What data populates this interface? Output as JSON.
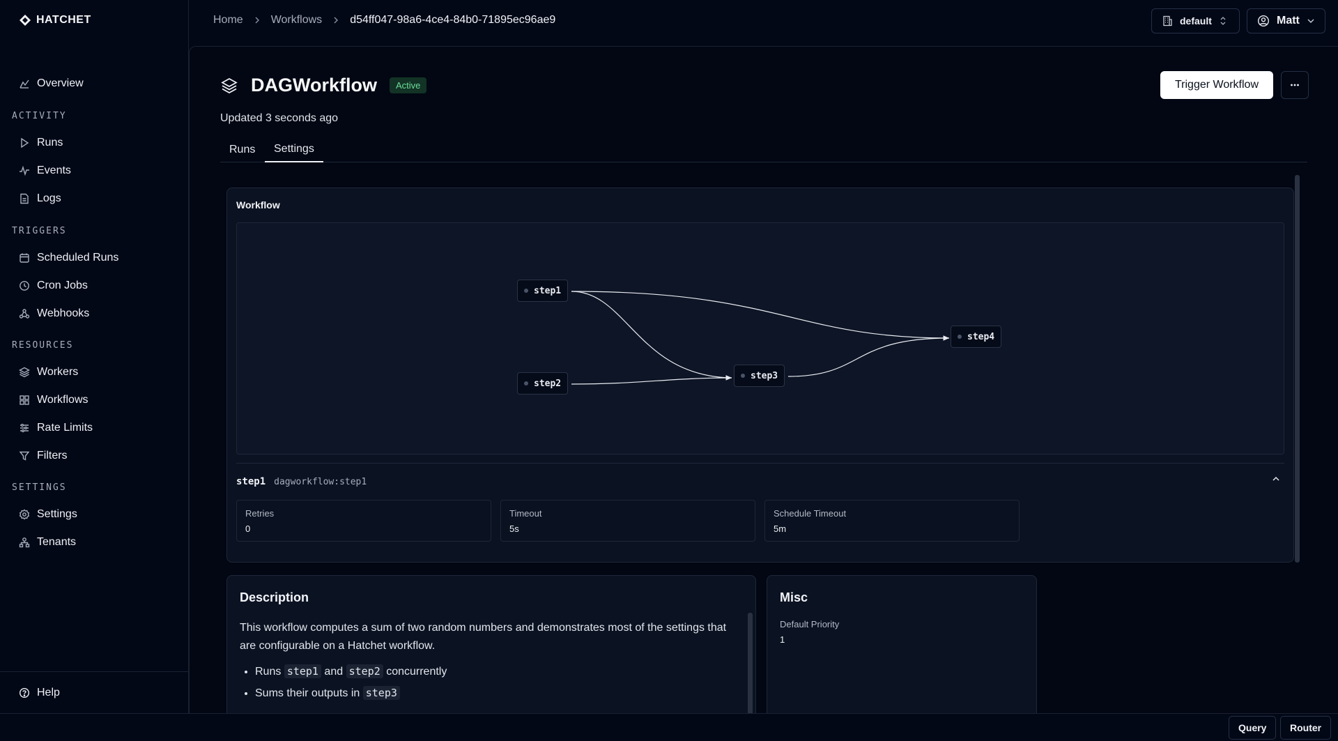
{
  "app": {
    "brand": "HATCHET"
  },
  "breadcrumb": {
    "home": "Home",
    "workflows": "Workflows",
    "current": "d54ff047-98a6-4ce4-84b0-71895ec96ae9"
  },
  "tenant_selector": {
    "label": "default",
    "icon": "building-icon"
  },
  "user_menu": {
    "label": "Matt",
    "icon": "user-circle-icon"
  },
  "sidebar": {
    "overview": "Overview",
    "sections": {
      "activity": "ACTIVITY",
      "triggers": "TRIGGERS",
      "resources": "RESOURCES",
      "settings": "SETTINGS"
    },
    "items": {
      "runs": "Runs",
      "events": "Events",
      "logs": "Logs",
      "scheduled_runs": "Scheduled Runs",
      "cron_jobs": "Cron Jobs",
      "webhooks": "Webhooks",
      "workers": "Workers",
      "workflows": "Workflows",
      "rate_limits": "Rate Limits",
      "filters": "Filters",
      "settings": "Settings",
      "tenants": "Tenants"
    },
    "help": "Help"
  },
  "page": {
    "title": "DAGWorkflow",
    "status": "Active",
    "updated": "Updated 3 seconds ago",
    "trigger_button": "Trigger Workflow",
    "tabs": {
      "runs": "Runs",
      "settings": "Settings"
    },
    "active_tab": "Settings"
  },
  "workflow_card": {
    "title": "Workflow",
    "dag": {
      "nodes": [
        "step1",
        "step2",
        "step3",
        "step4"
      ],
      "edges": [
        [
          "step1",
          "step3"
        ],
        [
          "step2",
          "step3"
        ],
        [
          "step1",
          "step4"
        ],
        [
          "step3",
          "step4"
        ]
      ]
    },
    "selected_step": {
      "name": "step1",
      "id": "dagworkflow:step1",
      "retries_label": "Retries",
      "retries": "0",
      "timeout_label": "Timeout",
      "timeout": "5s",
      "schedule_timeout_label": "Schedule Timeout",
      "schedule_timeout": "5m"
    }
  },
  "description": {
    "title": "Description",
    "text": "This workflow computes a sum of two random numbers and demonstrates most of the settings that are configurable on a Hatchet workflow.",
    "bullet1": {
      "pre": "Runs",
      "code1": "step1",
      "mid": "and",
      "code2": "step2",
      "post": "concurrently"
    },
    "bullet2": {
      "pre": "Sums their outputs in",
      "code": "step3"
    }
  },
  "misc": {
    "title": "Misc",
    "default_priority_label": "Default Priority",
    "default_priority": "1"
  },
  "bottom_bar": {
    "query": "Query",
    "router": "Router"
  }
}
